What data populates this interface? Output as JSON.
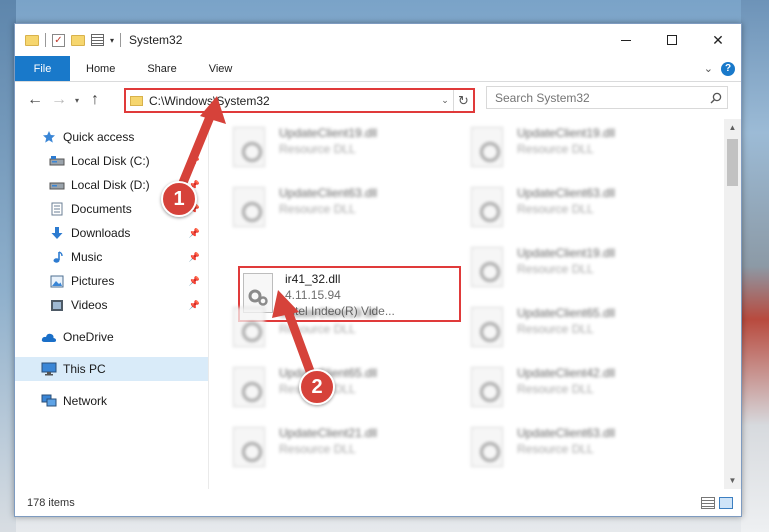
{
  "window": {
    "title": "System32",
    "quick_access_toolbar": [
      "folder-icon",
      "checkmark-properties-icon",
      "new-folder-icon",
      "properties-icon"
    ]
  },
  "ribbon": {
    "tabs": [
      {
        "label": "File",
        "active": true,
        "accent": "#1979ca"
      },
      {
        "label": "Home"
      },
      {
        "label": "Share"
      },
      {
        "label": "View"
      }
    ],
    "help_label": "?"
  },
  "address": {
    "path": "C:\\Windows\\System32",
    "highlight_color": "#e03a3a"
  },
  "search": {
    "placeholder": "Search System32"
  },
  "nav": {
    "items": [
      {
        "label": "Quick access",
        "icon": "star-icon",
        "level": 1
      },
      {
        "label": "Local Disk (C:)",
        "icon": "drive-icon",
        "level": 2,
        "pinned": true
      },
      {
        "label": "Local Disk (D:)",
        "icon": "drive-icon",
        "level": 2,
        "pinned": true
      },
      {
        "label": "Documents",
        "icon": "documents-icon",
        "level": 2,
        "pinned": true
      },
      {
        "label": "Downloads",
        "icon": "download-icon",
        "level": 2,
        "pinned": true
      },
      {
        "label": "Music",
        "icon": "music-icon",
        "level": 2,
        "pinned": true
      },
      {
        "label": "Pictures",
        "icon": "pictures-icon",
        "level": 2,
        "pinned": true
      },
      {
        "label": "Videos",
        "icon": "videos-icon",
        "level": 2,
        "pinned": true
      },
      {
        "label": "OneDrive",
        "icon": "cloud-icon",
        "level": 1
      },
      {
        "label": "This PC",
        "icon": "computer-icon",
        "level": 1,
        "selected": true
      },
      {
        "label": "Network",
        "icon": "network-icon",
        "level": 1
      }
    ]
  },
  "files": {
    "tiles": [
      {
        "name": "UpdateClient19.dll",
        "type": "Resource DLL"
      },
      {
        "name": "UpdateClient19.dll",
        "type": "Resource DLL"
      },
      {
        "name": "UpdateClient63.dll",
        "type": "Resource DLL"
      },
      {
        "name": "UpdateClient63.dll",
        "type": "Resource DLL"
      },
      {
        "name": "UpdateClient19.dll",
        "type": "Resource DLL"
      },
      {
        "name": "UpdateClient19.dll",
        "type": "Resource DLL"
      },
      {
        "name": "UpdateClient65.dll",
        "type": "Resource DLL"
      },
      {
        "name": "UpdateClient42.dll",
        "type": "Resource DLL"
      },
      {
        "name": "UpdateClient21.dll",
        "type": "Resource DLL"
      },
      {
        "name": "UpdateClient63.dll",
        "type": "Resource DLL"
      },
      {
        "name": "UpdateClient19.dll",
        "type": "Resource DLL"
      }
    ],
    "highlighted": {
      "name": "ir41_32.dll",
      "version": "4.11.15.94",
      "description": "Intel Indeo(R) Vide..."
    }
  },
  "status": {
    "item_count": "178 items"
  },
  "annotations": {
    "step1": "1",
    "step2": "2",
    "color": "#d6423a"
  }
}
